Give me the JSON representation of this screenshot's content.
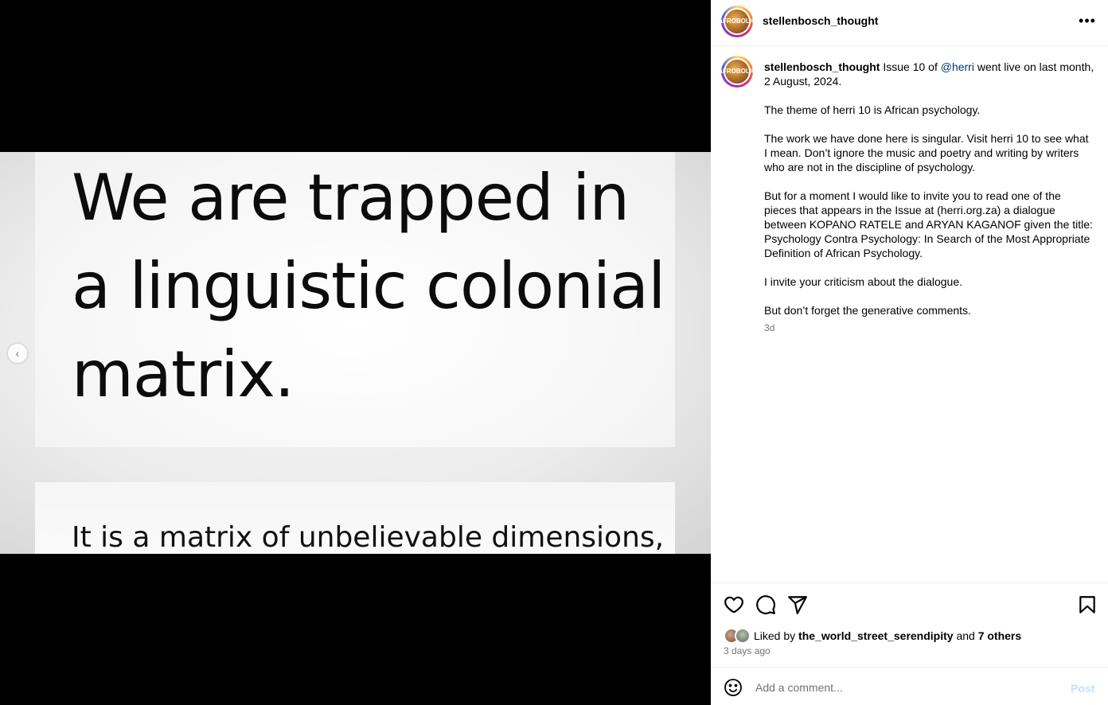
{
  "media": {
    "quote_line1": "We are trapped in",
    "quote_line2": "a linguistic colonial",
    "quote_line3": "matrix.",
    "sub_text": "It is a matrix of unbelievable dimensions,",
    "prev_glyph": "‹"
  },
  "header": {
    "username": "stellenbosch_thought",
    "more_glyph": "•••"
  },
  "caption": {
    "username": "stellenbosch_thought",
    "p1_pre": " Issue 10 of ",
    "mention": "@herri",
    "p1_post": " went live on last month, 2 August, 2024.",
    "p2": "The theme of herri 10 is African psychology.",
    "p3": "The work we have done here is singular. Visit herri 10 to see what I mean. Don’t ignore the music and poetry and writing by writers who are not in the discipline of psychology.",
    "p4": "But for a moment I would like to invite you to read one of the pieces that appears in the Issue at (herri.org.za) a dialogue between KOPANO RATELE and ARYAN KAGANOF given the title: Psychology Contra Psychology: In Search of the Most Appropriate Definition of African Psychology.",
    "p5": "I invite your criticism about the dialogue.",
    "p6": "But don’t forget the generative comments.",
    "age": "3d"
  },
  "avatar_text": "AFRO\nBOLIC",
  "likes": {
    "prefix": "Liked by ",
    "user": "the_world_street_serendipity",
    "middle": " and ",
    "others": "7 others"
  },
  "posted": "3 days ago",
  "comment": {
    "placeholder": "Add a comment...",
    "post_label": "Post"
  }
}
